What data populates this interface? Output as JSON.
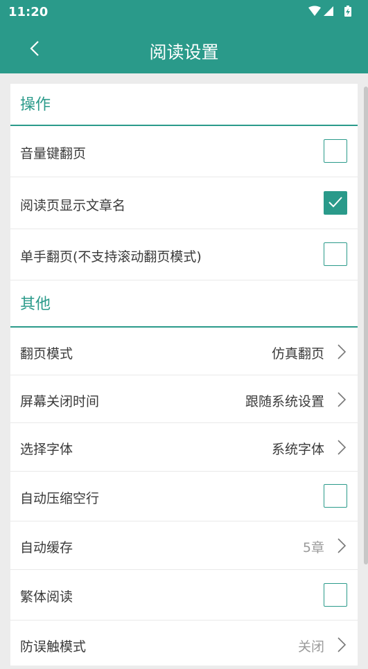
{
  "status_bar": {
    "time": "11:20"
  },
  "header": {
    "title": "阅读设置"
  },
  "sections": {
    "operation": {
      "title": "操作",
      "volume_key_page": {
        "label": "音量键翻页",
        "checked": false
      },
      "show_chapter_name": {
        "label": "阅读页显示文章名",
        "checked": true
      },
      "one_hand_page": {
        "label": "单手翻页(不支持滚动翻页模式)",
        "checked": false
      }
    },
    "other": {
      "title": "其他",
      "page_mode": {
        "label": "翻页模式",
        "value": "仿真翻页"
      },
      "screen_timeout": {
        "label": "屏幕关闭时间",
        "value": "跟随系统设置"
      },
      "font": {
        "label": "选择字体",
        "value": "系统字体"
      },
      "compress_blank": {
        "label": "自动压缩空行",
        "checked": false
      },
      "auto_cache": {
        "label": "自动缓存",
        "value": "5章"
      },
      "traditional": {
        "label": "繁体阅读",
        "checked": false
      },
      "anti_mistouch": {
        "label": "防误触模式",
        "value": "关闭"
      }
    }
  },
  "colors": {
    "primary": "#2a9a8a",
    "background": "#ececec",
    "muted_text": "#9a9a9a"
  }
}
